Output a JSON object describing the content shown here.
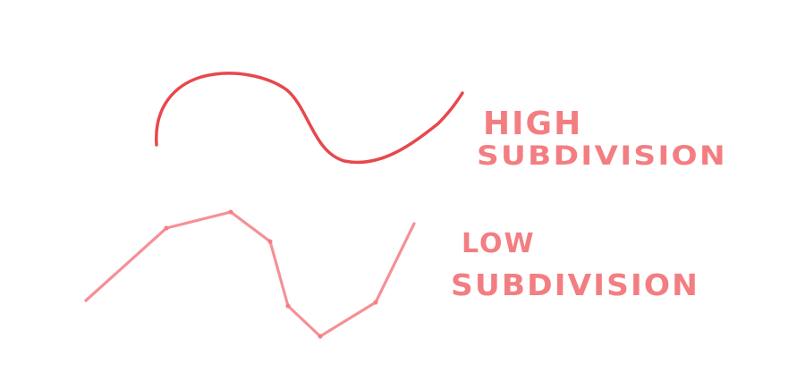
{
  "labels": {
    "high_line1": "HIGH",
    "high_line2": "SUBDIVISION",
    "low_line1": "LOW",
    "low_line2": "SUBDIVISION"
  },
  "colors": {
    "stroke_high": "#e8474c",
    "stroke_low": "#f47c82",
    "text": "#f05a60",
    "background": "#ffffff"
  }
}
